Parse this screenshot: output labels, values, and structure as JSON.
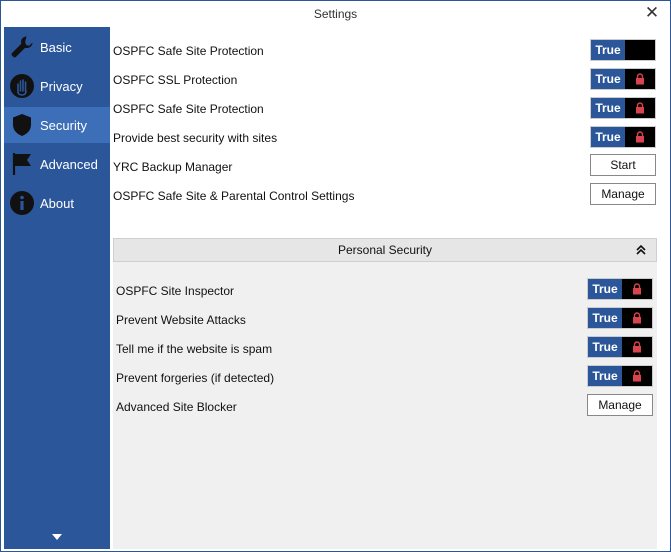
{
  "window": {
    "title": "Settings",
    "close_glyph": "✕"
  },
  "sidebar": {
    "items": [
      {
        "label": "Basic",
        "icon": "wrench-icon"
      },
      {
        "label": "Privacy",
        "icon": "hand-stop-icon"
      },
      {
        "label": "Security",
        "icon": "shield-icon",
        "active": true
      },
      {
        "label": "Advanced",
        "icon": "flag-icon"
      },
      {
        "label": "About",
        "icon": "info-icon"
      }
    ],
    "scroll_icon": "chevron-down-icon"
  },
  "main": {
    "rows": [
      {
        "label": "OSPFC Safe Site Protection",
        "type": "toggle",
        "value": "True",
        "locked": false
      },
      {
        "label": "OSPFC SSL Protection",
        "type": "toggle",
        "value": "True",
        "locked": true
      },
      {
        "label": "OSPFC Safe Site Protection",
        "type": "toggle",
        "value": "True",
        "locked": true
      },
      {
        "label": "Provide best security with sites",
        "type": "toggle",
        "value": "True",
        "locked": true
      },
      {
        "label": "YRC Backup Manager",
        "type": "button",
        "button_label": "Start"
      },
      {
        "label": "OSPFC Safe Site & Parental Control Settings",
        "type": "button",
        "button_label": "Manage"
      }
    ],
    "section": {
      "title": "Personal Security",
      "rows": [
        {
          "label": "OSPFC Site Inspector",
          "type": "toggle",
          "value": "True",
          "locked": true
        },
        {
          "label": "Prevent Website Attacks",
          "type": "toggle",
          "value": "True",
          "locked": true
        },
        {
          "label": "Tell me if the website is spam",
          "type": "toggle",
          "value": "True",
          "locked": true
        },
        {
          "label": "Prevent forgeries (if detected)",
          "type": "toggle",
          "value": "True",
          "locked": true
        },
        {
          "label": "Advanced Site Blocker",
          "type": "button",
          "button_label": "Manage"
        }
      ]
    }
  },
  "colors": {
    "sidebar": "#2b579a",
    "sidebar_active": "#3d6fb8",
    "toggle_true": "#2b579a",
    "lock": "#d9434d"
  }
}
